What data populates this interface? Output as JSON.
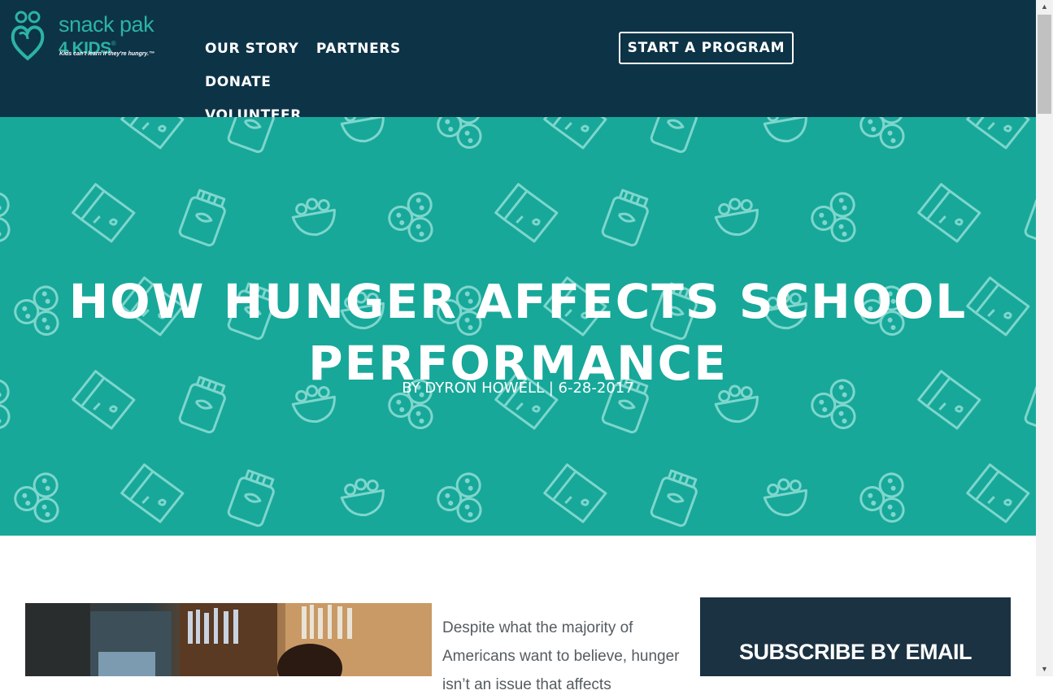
{
  "brand": {
    "name_line1": "snack pak",
    "name_line2": "4 KIDS",
    "trademark": "®",
    "tagline": "Kids can't learn if they're hungry.™"
  },
  "nav": {
    "items": [
      {
        "label": "OUR STORY"
      },
      {
        "label": "PARTNERS"
      },
      {
        "label": "DONATE"
      },
      {
        "label": "VOLUNTEER"
      }
    ],
    "cta_label": "START A PROGRAM"
  },
  "hero": {
    "title": "HOW HUNGER AFFECTS SCHOOL PERFORMANCE",
    "byline": "BY DYRON HOWELL | 6-28-2017"
  },
  "article": {
    "intro": "Despite what the majority of Americans want to believe, hunger isn’t an issue that affects"
  },
  "sidebar": {
    "subscribe_title": "SUBSCRIBE BY EMAIL"
  },
  "icons": {
    "logo": "snack-pak-heart-logo",
    "pattern": [
      "milk-carton-icon",
      "snack-jar-icon",
      "cereal-bowl-icon",
      "cookies-icon"
    ],
    "scroll_up": "triangle-up-icon",
    "scroll_down": "triangle-down-icon"
  },
  "colors": {
    "header_bg": "#0d3347",
    "hero_bg": "#17a89a",
    "brand_teal": "#2cb3a3",
    "sidebar_bg": "#1b3242",
    "body_text": "#555c61"
  }
}
